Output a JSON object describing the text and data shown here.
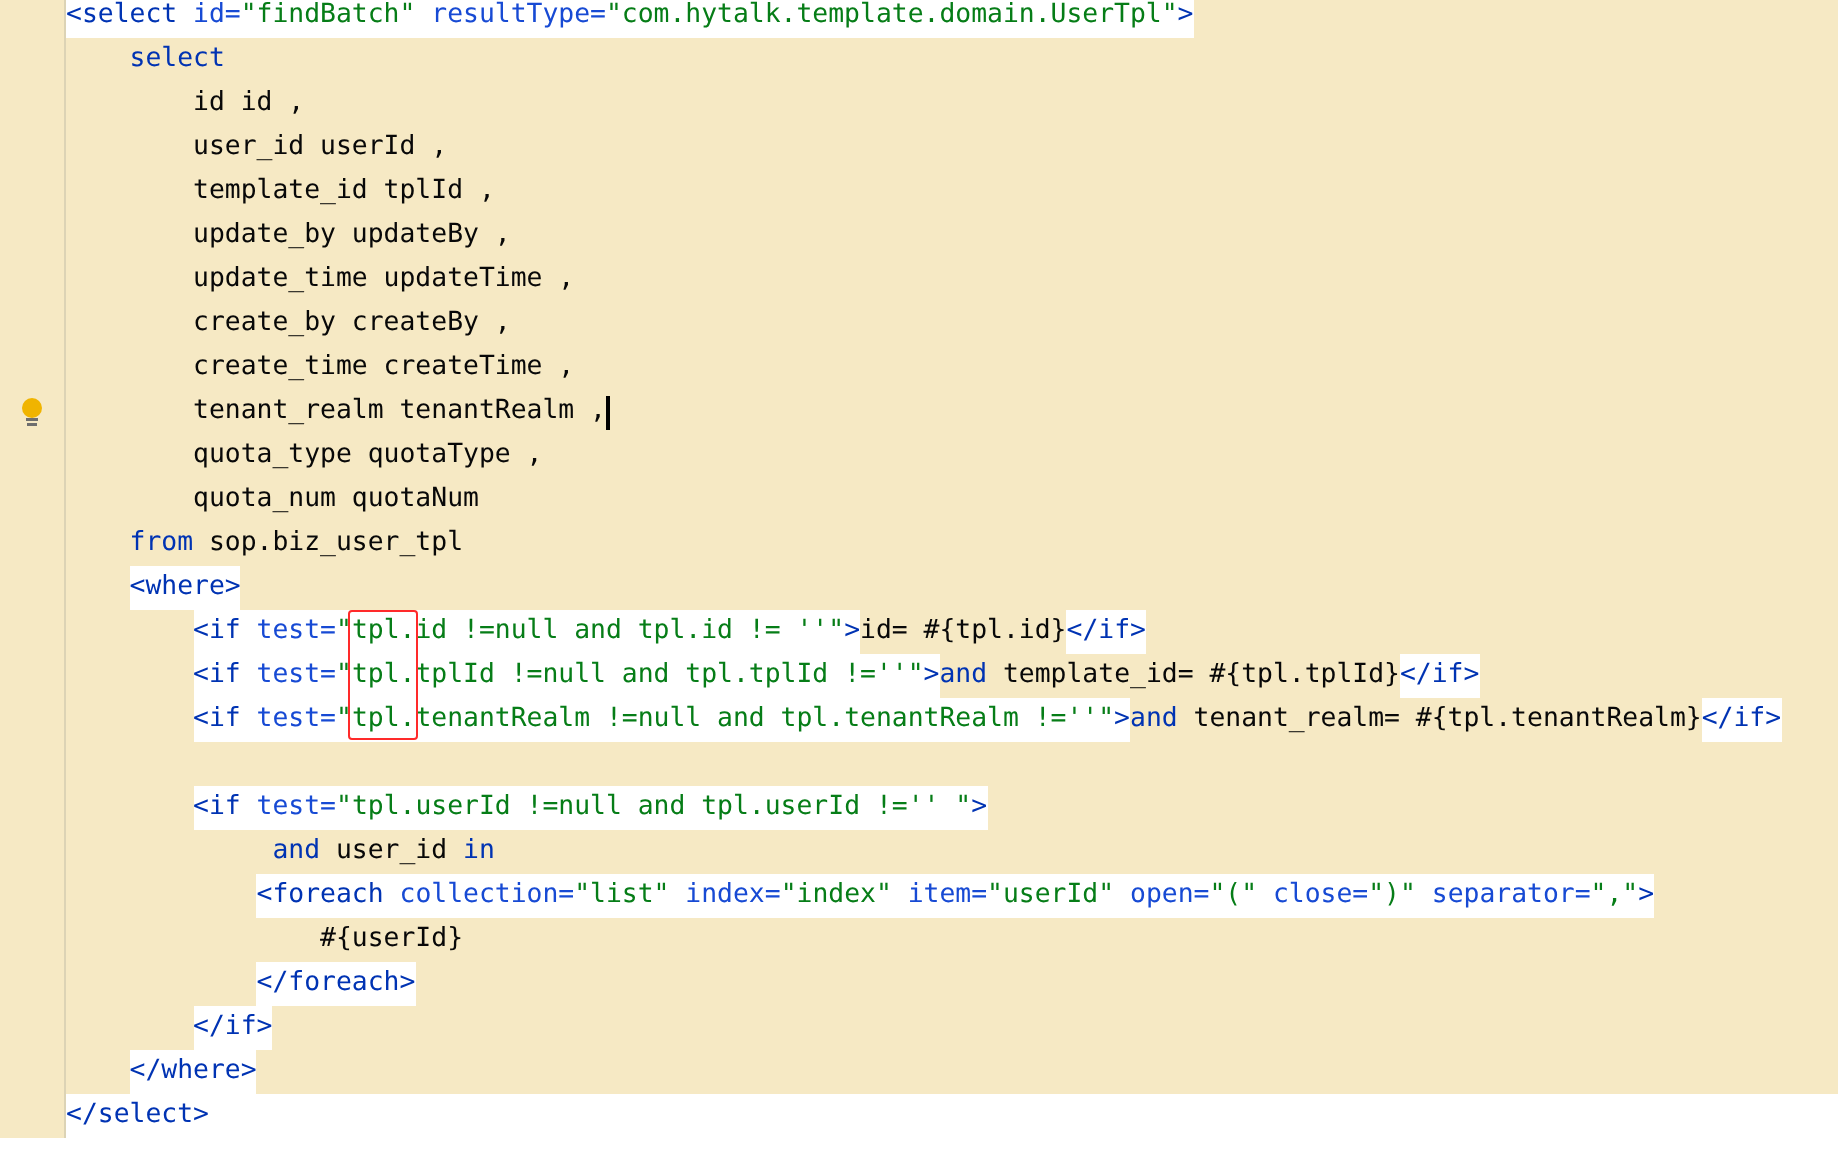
{
  "lines": [
    {
      "bulb": false,
      "caret": false,
      "tokens": [
        {
          "kind": "tag",
          "text": "<select",
          "hl": true
        },
        {
          "kind": "attr",
          "text": " id=",
          "hl": true
        },
        {
          "kind": "str",
          "text": "\"findBatch\"",
          "hl": true
        },
        {
          "kind": "attr",
          "text": " resultType=",
          "hl": true
        },
        {
          "kind": "str",
          "text": "\"com.hytalk.template.domain.UserTpl\"",
          "hl": true
        },
        {
          "kind": "tag",
          "text": ">",
          "hl": true
        }
      ]
    },
    {
      "bulb": false,
      "caret": false,
      "tokens": [
        {
          "kind": "kw",
          "text": "    select",
          "hl": false
        }
      ]
    },
    {
      "bulb": false,
      "caret": false,
      "tokens": [
        {
          "kind": "text",
          "text": "        id id ,",
          "hl": false
        }
      ]
    },
    {
      "bulb": false,
      "caret": false,
      "tokens": [
        {
          "kind": "text",
          "text": "        user_id userId ,",
          "hl": false
        }
      ]
    },
    {
      "bulb": false,
      "caret": false,
      "tokens": [
        {
          "kind": "text",
          "text": "        template_id tplId ,",
          "hl": false
        }
      ]
    },
    {
      "bulb": false,
      "caret": false,
      "tokens": [
        {
          "kind": "text",
          "text": "        update_by updateBy ,",
          "hl": false
        }
      ]
    },
    {
      "bulb": false,
      "caret": false,
      "tokens": [
        {
          "kind": "text",
          "text": "        update_time updateTime ,",
          "hl": false
        }
      ]
    },
    {
      "bulb": false,
      "caret": false,
      "tokens": [
        {
          "kind": "text",
          "text": "        create_by createBy ,",
          "hl": false
        }
      ]
    },
    {
      "bulb": false,
      "caret": false,
      "tokens": [
        {
          "kind": "text",
          "text": "        create_time createTime ,",
          "hl": false
        }
      ]
    },
    {
      "bulb": true,
      "caret": true,
      "tokens": [
        {
          "kind": "text",
          "text": "        tenant_realm tenantRealm ,",
          "hl": false
        }
      ]
    },
    {
      "bulb": false,
      "caret": false,
      "tokens": [
        {
          "kind": "text",
          "text": "        quota_type quotaType ,",
          "hl": false
        }
      ]
    },
    {
      "bulb": false,
      "caret": false,
      "tokens": [
        {
          "kind": "text",
          "text": "        quota_num quotaNum",
          "hl": false
        }
      ]
    },
    {
      "bulb": false,
      "caret": false,
      "tokens": [
        {
          "kind": "kw",
          "text": "    from",
          "hl": false
        },
        {
          "kind": "text",
          "text": " sop.biz_user_tpl",
          "hl": false
        }
      ]
    },
    {
      "bulb": false,
      "caret": false,
      "tokens": [
        {
          "kind": "tag",
          "text": "    <where>",
          "hl": true
        }
      ]
    },
    {
      "bulb": false,
      "caret": false,
      "tokens": [
        {
          "kind": "tag",
          "text": "        <if",
          "hl": true
        },
        {
          "kind": "attr",
          "text": " test=",
          "hl": true
        },
        {
          "kind": "str",
          "text": "\"tpl.id !=null and tpl.id != ''\"",
          "hl": true
        },
        {
          "kind": "tag",
          "text": ">",
          "hl": true
        },
        {
          "kind": "text",
          "text": "id= #{tpl.id}",
          "hl": false
        },
        {
          "kind": "tag",
          "text": "</if>",
          "hl": true
        }
      ]
    },
    {
      "bulb": false,
      "caret": false,
      "tokens": [
        {
          "kind": "tag",
          "text": "        <if",
          "hl": true
        },
        {
          "kind": "attr",
          "text": " test=",
          "hl": true
        },
        {
          "kind": "str",
          "text": "\"tpl.tplId !=null and tpl.tplId !=''\"",
          "hl": true
        },
        {
          "kind": "tag",
          "text": ">",
          "hl": true
        },
        {
          "kind": "kw",
          "text": "and",
          "hl": false
        },
        {
          "kind": "text",
          "text": " template_id= #{tpl.tplId}",
          "hl": false
        },
        {
          "kind": "tag",
          "text": "</if>",
          "hl": true
        }
      ]
    },
    {
      "bulb": false,
      "caret": false,
      "tokens": [
        {
          "kind": "tag",
          "text": "        <if",
          "hl": true
        },
        {
          "kind": "attr",
          "text": " test=",
          "hl": true
        },
        {
          "kind": "str",
          "text": "\"tpl.tenantRealm !=null and tpl.tenantRealm !=''\"",
          "hl": true
        },
        {
          "kind": "tag",
          "text": ">",
          "hl": true
        },
        {
          "kind": "kw",
          "text": "and",
          "hl": false
        },
        {
          "kind": "text",
          "text": " tenant_realm= #{tpl.tenantRealm}",
          "hl": false
        },
        {
          "kind": "tag",
          "text": "</if>",
          "hl": true
        }
      ]
    },
    {
      "bulb": false,
      "caret": false
    },
    {
      "bulb": false,
      "caret": false,
      "tokens": [
        {
          "kind": "tag",
          "text": "        <if",
          "hl": true
        },
        {
          "kind": "attr",
          "text": " test=",
          "hl": true
        },
        {
          "kind": "str",
          "text": "\"tpl.userId !=null and tpl.userId !='' \"",
          "hl": true
        },
        {
          "kind": "tag",
          "text": ">",
          "hl": true
        }
      ]
    },
    {
      "bulb": false,
      "caret": false,
      "tokens": [
        {
          "kind": "kw",
          "text": "             and",
          "hl": false
        },
        {
          "kind": "text",
          "text": " user_id ",
          "hl": false
        },
        {
          "kind": "kw",
          "text": "in",
          "hl": false
        }
      ]
    },
    {
      "bulb": false,
      "caret": false,
      "tokens": [
        {
          "kind": "tag",
          "text": "            <foreach",
          "hl": true
        },
        {
          "kind": "attr",
          "text": " collection=",
          "hl": true
        },
        {
          "kind": "str",
          "text": "\"list\"",
          "hl": true
        },
        {
          "kind": "attr",
          "text": " index=",
          "hl": true
        },
        {
          "kind": "str",
          "text": "\"index\"",
          "hl": true
        },
        {
          "kind": "attr",
          "text": " item=",
          "hl": true
        },
        {
          "kind": "str",
          "text": "\"userId\"",
          "hl": true
        },
        {
          "kind": "attr",
          "text": " open=",
          "hl": true
        },
        {
          "kind": "str",
          "text": "\"(\"",
          "hl": true
        },
        {
          "kind": "attr",
          "text": " close=",
          "hl": true
        },
        {
          "kind": "str",
          "text": "\")\"",
          "hl": true
        },
        {
          "kind": "attr",
          "text": " separator=",
          "hl": true
        },
        {
          "kind": "str",
          "text": "\",\"",
          "hl": true
        },
        {
          "kind": "tag",
          "text": ">",
          "hl": true
        }
      ]
    },
    {
      "bulb": false,
      "caret": false,
      "tokens": [
        {
          "kind": "text",
          "text": "                #{userId}",
          "hl": false
        }
      ]
    },
    {
      "bulb": false,
      "caret": false,
      "tokens": [
        {
          "kind": "tag",
          "text": "            </foreach>",
          "hl": true
        }
      ]
    },
    {
      "bulb": false,
      "caret": false,
      "tokens": [
        {
          "kind": "tag",
          "text": "        </if>",
          "hl": true
        }
      ]
    },
    {
      "bulb": false,
      "caret": false,
      "tokens": [
        {
          "kind": "tag",
          "text": "    </where>",
          "hl": true
        }
      ]
    },
    {
      "bulb": false,
      "caret": false,
      "tokens": [
        {
          "kind": "tag",
          "text": "</select>"
        }
      ]
    }
  ]
}
